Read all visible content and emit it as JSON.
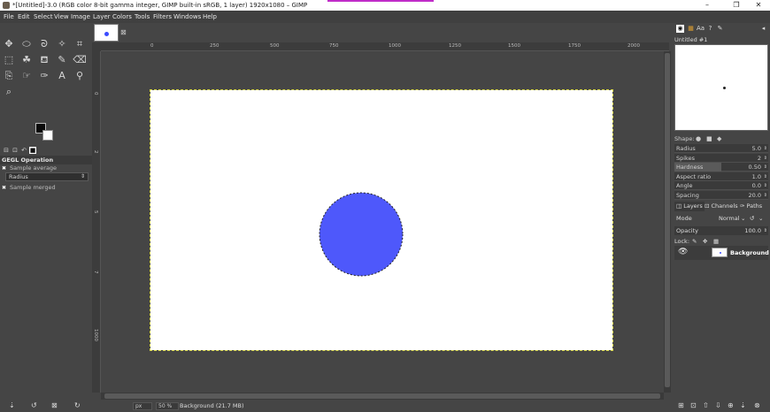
{
  "window": {
    "title": "*[Untitled]-3.0 (RGB color 8-bit gamma integer, GIMP built-in sRGB, 1 layer) 1920x1080 – GIMP",
    "minimize": "–",
    "maximize": "❐",
    "close": "✕"
  },
  "menubar": [
    "File",
    "Edit",
    "Select",
    "View",
    "Image",
    "Layer",
    "Colors",
    "Tools",
    "Filters",
    "Windows",
    "Help"
  ],
  "toolbox": {
    "tools": [
      {
        "name": "move-tool-icon",
        "glyph": "✥"
      },
      {
        "name": "ellipse-select-icon",
        "glyph": "⬭"
      },
      {
        "name": "lasso-select-icon",
        "glyph": "ᘐ"
      },
      {
        "name": "fuzzy-select-icon",
        "glyph": "✧"
      },
      {
        "name": "crop-icon",
        "glyph": "⌗"
      },
      {
        "name": "transform-icon",
        "glyph": "⬚"
      },
      {
        "name": "warp-icon",
        "glyph": "☘"
      },
      {
        "name": "bucket-fill-icon",
        "glyph": "⛾"
      },
      {
        "name": "paintbrush-icon",
        "glyph": "✎"
      },
      {
        "name": "eraser-icon",
        "glyph": "⌫"
      },
      {
        "name": "clone-icon",
        "glyph": "⎘"
      },
      {
        "name": "smudge-icon",
        "glyph": "☞"
      },
      {
        "name": "paths-icon",
        "glyph": "✑"
      },
      {
        "name": "text-tool-icon",
        "glyph": "A"
      },
      {
        "name": "color-picker-icon",
        "glyph": "⚲"
      },
      {
        "name": "zoom-icon",
        "glyph": "⌕"
      }
    ],
    "tool_options_title": "GEGL Operation",
    "sample_average": "Sample average",
    "radius_label": "Radius",
    "sample_merged": "Sample merged",
    "spin_glyph": "⇕",
    "bottom_icons": [
      "⇣",
      "↺",
      "⊠",
      "↻"
    ]
  },
  "image_tab": {
    "close": "⊠"
  },
  "rulers": {
    "top": [
      "0",
      "250",
      "500",
      "750",
      "1000",
      "1250",
      "1500",
      "1750",
      "2000"
    ],
    "left": [
      "0",
      "2",
      "5",
      "7",
      "1000"
    ]
  },
  "statusbar": {
    "unit": "px",
    "zoom": "50 %",
    "message": "Background (21.7 MB)"
  },
  "brushes": {
    "name": "Untitled #1",
    "shape_label": "Shape:",
    "sliders": [
      {
        "label": "Radius",
        "value": "5.0",
        "fraction": 0.0
      },
      {
        "label": "Spikes",
        "value": "2",
        "fraction": 0.0
      },
      {
        "label": "Hardness",
        "value": "0.50",
        "fraction": 0.5
      },
      {
        "label": "Aspect ratio",
        "value": "1.0",
        "fraction": 0.0
      },
      {
        "label": "Angle",
        "value": "0.0",
        "fraction": 0.0
      },
      {
        "label": "Spacing",
        "value": "20.0",
        "fraction": 0.0
      }
    ]
  },
  "layers": {
    "tabs": [
      "Layers",
      "Channels",
      "Paths"
    ],
    "mode_label": "Mode",
    "mode_value": "Normal",
    "opacity_label": "Opacity",
    "opacity_value": "100.0",
    "lock_label": "Lock:",
    "layer_name": "Background",
    "bottom_icons": [
      "⊞",
      "⊡",
      "⇧",
      "⇩",
      "⊕",
      "⇣",
      "⊗"
    ]
  },
  "colors": {
    "circle_fill": "#4e58fb",
    "foreground": "#0a0a0a",
    "background": "#ffffff"
  }
}
